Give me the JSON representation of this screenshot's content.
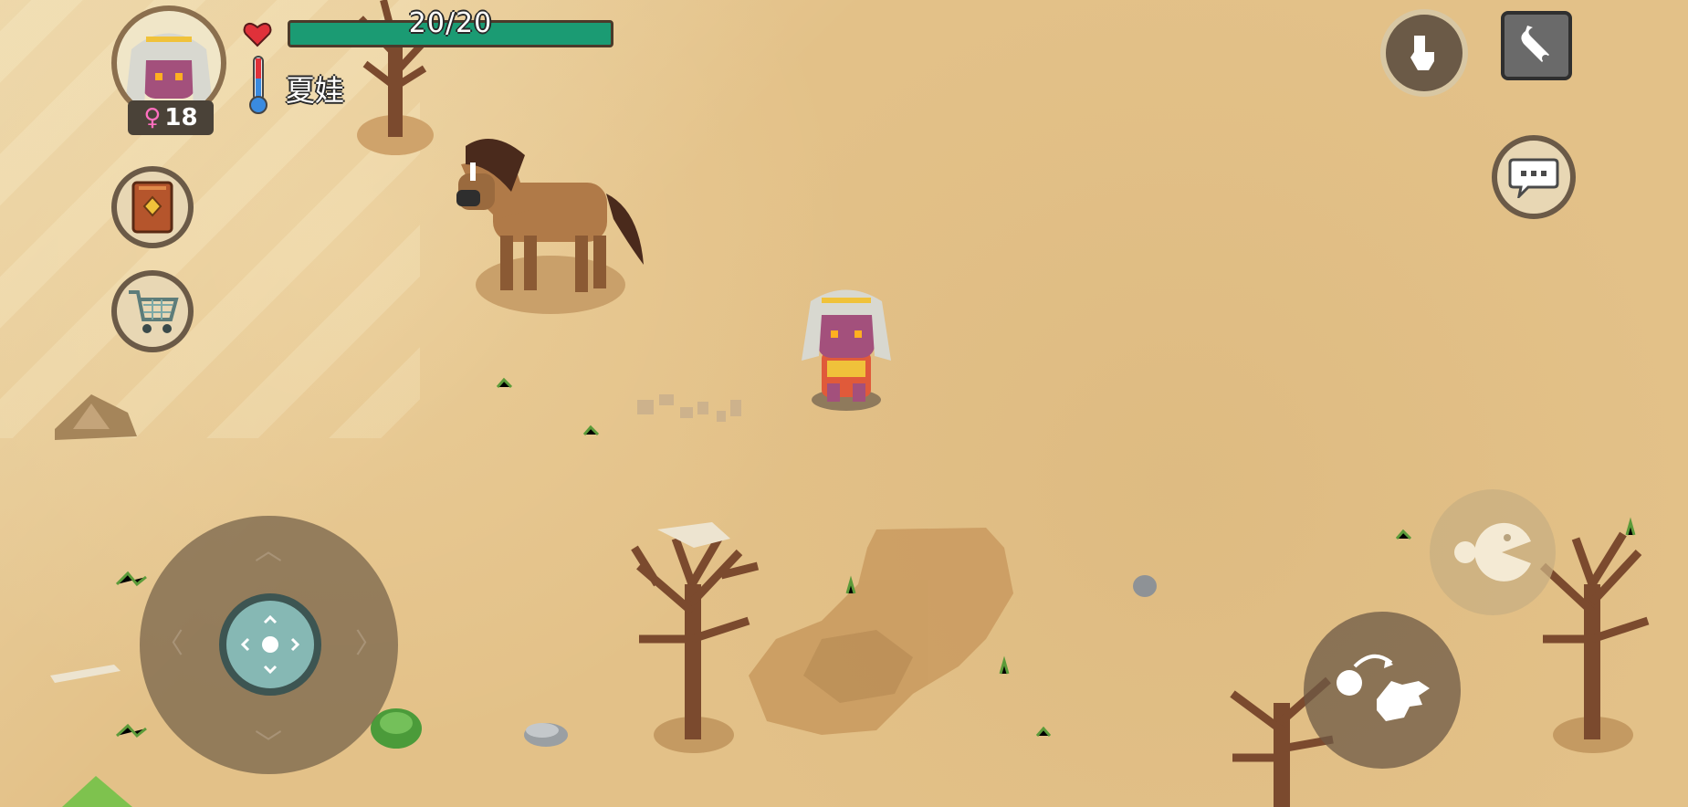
{
  "hud": {
    "health": "20/20",
    "player_name": "夏娃",
    "age": "18",
    "gender_symbol": "♀"
  },
  "colors": {
    "health_bar": "#1b9b73",
    "sand": "#e3c188",
    "heart": "#e0313a"
  },
  "icons": {
    "recipe_book": "book-icon",
    "shop": "shopping-cart-icon",
    "drop": "drop-item-icon",
    "settings": "wrench-icon",
    "chat": "speech-bubble-icon",
    "eat": "eat-icon",
    "interact": "hand-throw-icon"
  }
}
